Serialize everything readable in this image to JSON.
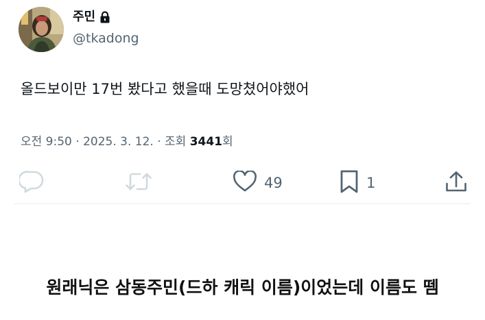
{
  "tweet": {
    "display_name": "주민",
    "username": "@tkadong",
    "text": "올드보이만 17번 봤다고 했을때 도망쳤어야했어",
    "meta": {
      "time": "오전 9:50",
      "separator": " · ",
      "date": "2025. 3. 12.",
      "views_label": "조회",
      "views_count": "3441",
      "views_suffix": "회"
    },
    "actions": {
      "reply_count": "",
      "retweet_count": "",
      "like_count": "49",
      "bookmark_count": "1"
    }
  },
  "caption": "원래닉은 삼동주민(드하 캐릭 이름)이었는데 이름도 뗌",
  "colors": {
    "text_primary": "#0f1419",
    "text_secondary": "#536471",
    "icon_faded": "#cfd9de",
    "divider": "#e6ecf0"
  },
  "icons": {
    "lock": "lock-icon",
    "reply": "reply-icon",
    "retweet": "retweet-icon",
    "like": "heart-icon",
    "bookmark": "bookmark-icon",
    "share": "share-icon"
  }
}
